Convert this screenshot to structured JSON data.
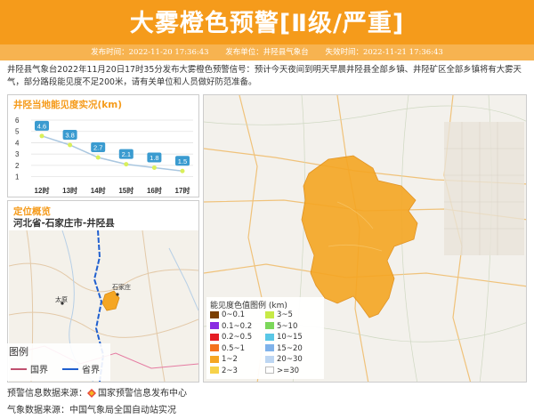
{
  "header": {
    "title": "大雾橙色预警[Ⅱ级/严重]",
    "issue_time_label": "发布时间：2022-11-20 17:36:43",
    "issuer_label": "发布单位：井陉县气象台",
    "expire_label": "失效时间：2022-11-21 17:36:43"
  },
  "bulletin": "井陉县气象台2022年11月20日17时35分发布大雾橙色预警信号：预计今天夜间到明天早晨井陉县全部乡镇、井陉矿区全部乡镇将有大雾天气，部分路段能见度不足200米，请有关单位和人员做好防范准备。",
  "visibility_panel": {
    "title": "井陉当地能见度实况(km)"
  },
  "chart_data": {
    "type": "line",
    "title": "井陉当地能见度实况(km)",
    "categories": [
      "12时",
      "13时",
      "14时",
      "15时",
      "16时",
      "17时"
    ],
    "values": [
      4.6,
      3.8,
      2.7,
      2.1,
      1.8,
      1.5
    ],
    "y_ticks": [
      "1",
      "2",
      "3",
      "4",
      "5",
      "6"
    ],
    "ylim": [
      0.5,
      6
    ],
    "grid": true,
    "line_color": "#aac7e0",
    "point_color": "#d9ef5a",
    "label_bg": "#3a9bd0"
  },
  "location_panel": {
    "title": "定位概览",
    "region": "河北省-石家庄市-井陉县",
    "city_label_1": "石家庄",
    "city_label_2": "太原",
    "legend_title": "图例",
    "legend_border": "国界",
    "legend_province": "省界"
  },
  "map_legend": {
    "title": "能见度色值图例 (km)",
    "items": [
      {
        "label": "0~0.1",
        "color": "#7b3f00"
      },
      {
        "label": "0.1~0.2",
        "color": "#8a2be2"
      },
      {
        "label": "0.2~0.5",
        "color": "#e51c23"
      },
      {
        "label": "0.5~1",
        "color": "#f4721e"
      },
      {
        "label": "1~2",
        "color": "#f5a623"
      },
      {
        "label": "2~3",
        "color": "#f7d24a"
      },
      {
        "label": "3~5",
        "color": "#c7ea46"
      },
      {
        "label": "5~10",
        "color": "#7bd75a"
      },
      {
        "label": "10~15",
        "color": "#5ac7e6"
      },
      {
        "label": "15~20",
        "color": "#7fb2ea"
      },
      {
        "label": "20~30",
        "color": "#bdd6f2"
      },
      {
        "label": ">=30",
        "color": "#ffffff"
      }
    ]
  },
  "footer": {
    "line1_prefix": "预警信息数据来源：",
    "line1_source": "国家预警信息发布中心",
    "line2": "气象数据来源：中国气象局全国自动站实况"
  },
  "colors": {
    "accent": "#f59b1b",
    "warning_area": "#f5a623"
  }
}
